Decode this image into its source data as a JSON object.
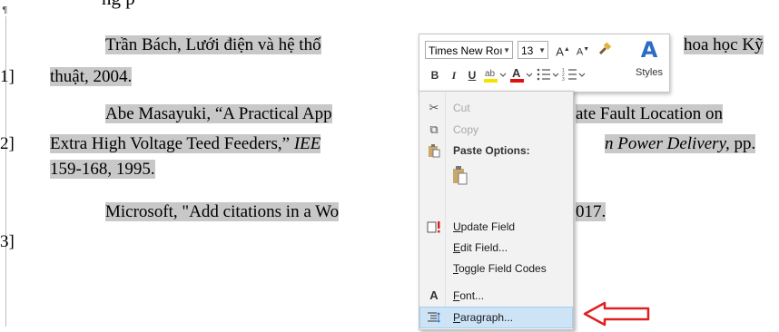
{
  "document": {
    "heading_fragment": "ng p",
    "para_mark": "¶",
    "ref1": {
      "line1": "Trần Bách, Lưới điện và hệ thố",
      "line1_end": "hoa học Kỹ",
      "num": "1]",
      "line2": "thuật, 2004."
    },
    "ref2": {
      "line1": "Abe Masayuki, “A Practical App",
      "line1_end": "ate Fault Location on",
      "num": "2]",
      "line2_pre": "Extra High Voltage Teed Feeders,” ",
      "line2_ital": "IEE",
      "line2_end_ital": "n Power Delivery,",
      "line2_end": " pp.",
      "line3": "159-168, 1995."
    },
    "ref3": {
      "line1": "Microsoft, \"Add citations in a Wo",
      "line1_end": "017.",
      "num": "3]"
    }
  },
  "mini_toolbar": {
    "font_name": "Times New Roı",
    "font_size": "13",
    "grow_font": "A",
    "shrink_font": "A",
    "bold": "B",
    "italic": "I",
    "underline": "U",
    "styles_glyph": "A",
    "styles_label": "Styles"
  },
  "context_menu": {
    "cut": "Cut",
    "copy": "Copy",
    "paste_options": "Paste Options:",
    "update_field": "Update Field",
    "edit_field": "Edit Field...",
    "toggle_field_codes": "Toggle Field Codes",
    "font": "Font...",
    "paragraph": "Paragraph..."
  },
  "colors": {
    "highlight": "#c8c8c8",
    "selected_item": "#cde4f7",
    "arrow": "#e02020",
    "styles_blue": "#2b6cc4"
  }
}
